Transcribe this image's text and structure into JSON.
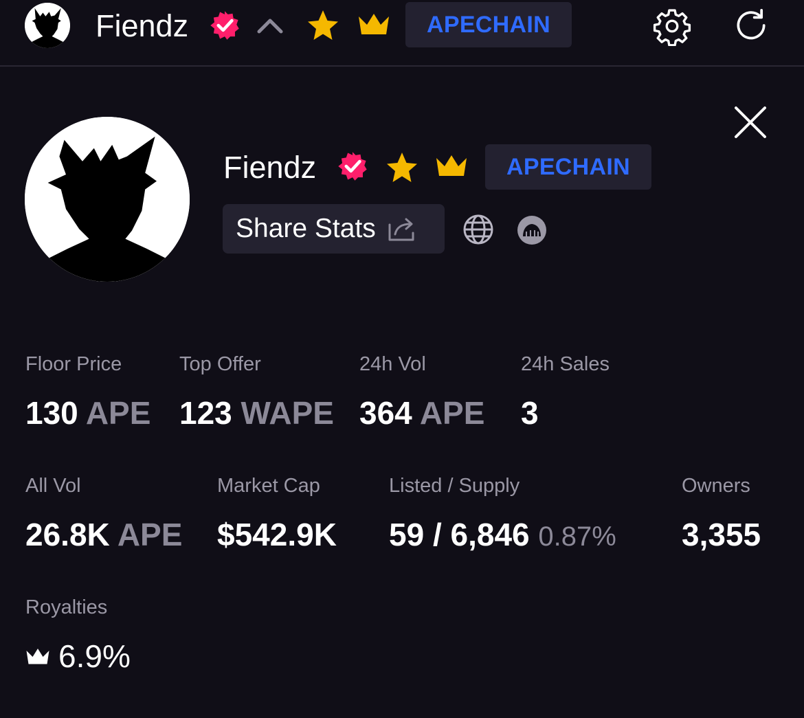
{
  "header": {
    "collection_name": "Fiendz",
    "chain_badge": "APECHAIN",
    "icons": [
      "avatar",
      "verified-badge-icon",
      "chevron-up-icon",
      "star-icon",
      "crown-icon",
      "settings-icon",
      "refresh-icon"
    ]
  },
  "profile": {
    "name": "Fiendz",
    "chain_badge": "APECHAIN",
    "share_label": "Share Stats",
    "icons": [
      "verified-badge-icon",
      "star-icon",
      "crown-icon",
      "share-icon",
      "globe-icon",
      "ape-icon",
      "close-icon"
    ]
  },
  "stats": {
    "floor": {
      "label": "Floor Price",
      "value": "130",
      "unit": "APE"
    },
    "top_offer": {
      "label": "Top Offer",
      "value": "123",
      "unit": "WAPE"
    },
    "vol_24h": {
      "label": "24h Vol",
      "value": "364",
      "unit": "APE"
    },
    "sales_24h": {
      "label": "24h Sales",
      "value": "3"
    },
    "all_vol": {
      "label": "All Vol",
      "value": "26.8K",
      "unit": "APE"
    },
    "market_cap": {
      "label": "Market Cap",
      "value": "$542.9K"
    },
    "listed_supply": {
      "label": "Listed / Supply",
      "value": "59 / 6,846",
      "pct": "0.87%"
    },
    "owners": {
      "label": "Owners",
      "value": "3,355"
    },
    "royalties": {
      "label": "Royalties",
      "value": "6.9%"
    }
  },
  "colors": {
    "background": "#100e17",
    "chip_bg": "#232130",
    "chain_blue": "#2f6bff",
    "verified_pink": "#ff1f6b",
    "gold": "#f5b800",
    "muted_text": "#9b98a6"
  }
}
